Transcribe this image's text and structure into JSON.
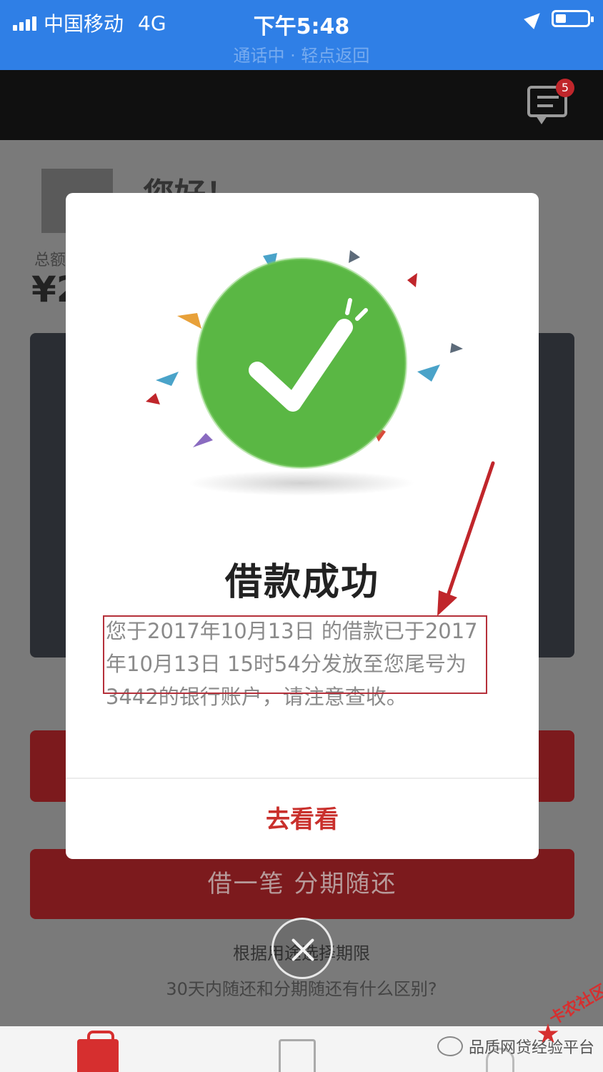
{
  "status_bar": {
    "carrier": "中国移动",
    "network": "4G",
    "time": "下午5:48",
    "call_banner": "通话中 · 轻点返回"
  },
  "nav": {
    "message_badge": "5"
  },
  "background_page": {
    "greeting": "您好！",
    "total_label": "总额",
    "total_value_prefix": "¥2",
    "borrow_button": "借一笔 分期随还",
    "hint_period": "根据用途选择期限",
    "hint_question": "30天内随还和分期随还有什么区别?"
  },
  "modal": {
    "title": "借款成功",
    "message_line1": "您于2017年10月13日 的借款已于2017",
    "message_line2": "年10月13日 15时54分发放至您尾号为",
    "message_line3": "3442的银行账户，请注意查收。",
    "action_label": "去看看"
  },
  "watermark": {
    "text": "品质网贷经验平台",
    "corner_logo": "卡农社区"
  },
  "colors": {
    "status_bar": "#2f7fe6",
    "check_green": "#5ab744",
    "accent_red": "#c9302c",
    "annotation_red": "#b5303a"
  },
  "icons": [
    "signal-icon",
    "location-arrow-icon",
    "battery-icon",
    "message-icon",
    "success-check-icon",
    "close-icon",
    "home-tab-icon",
    "loan-tab-icon",
    "me-tab-icon"
  ]
}
